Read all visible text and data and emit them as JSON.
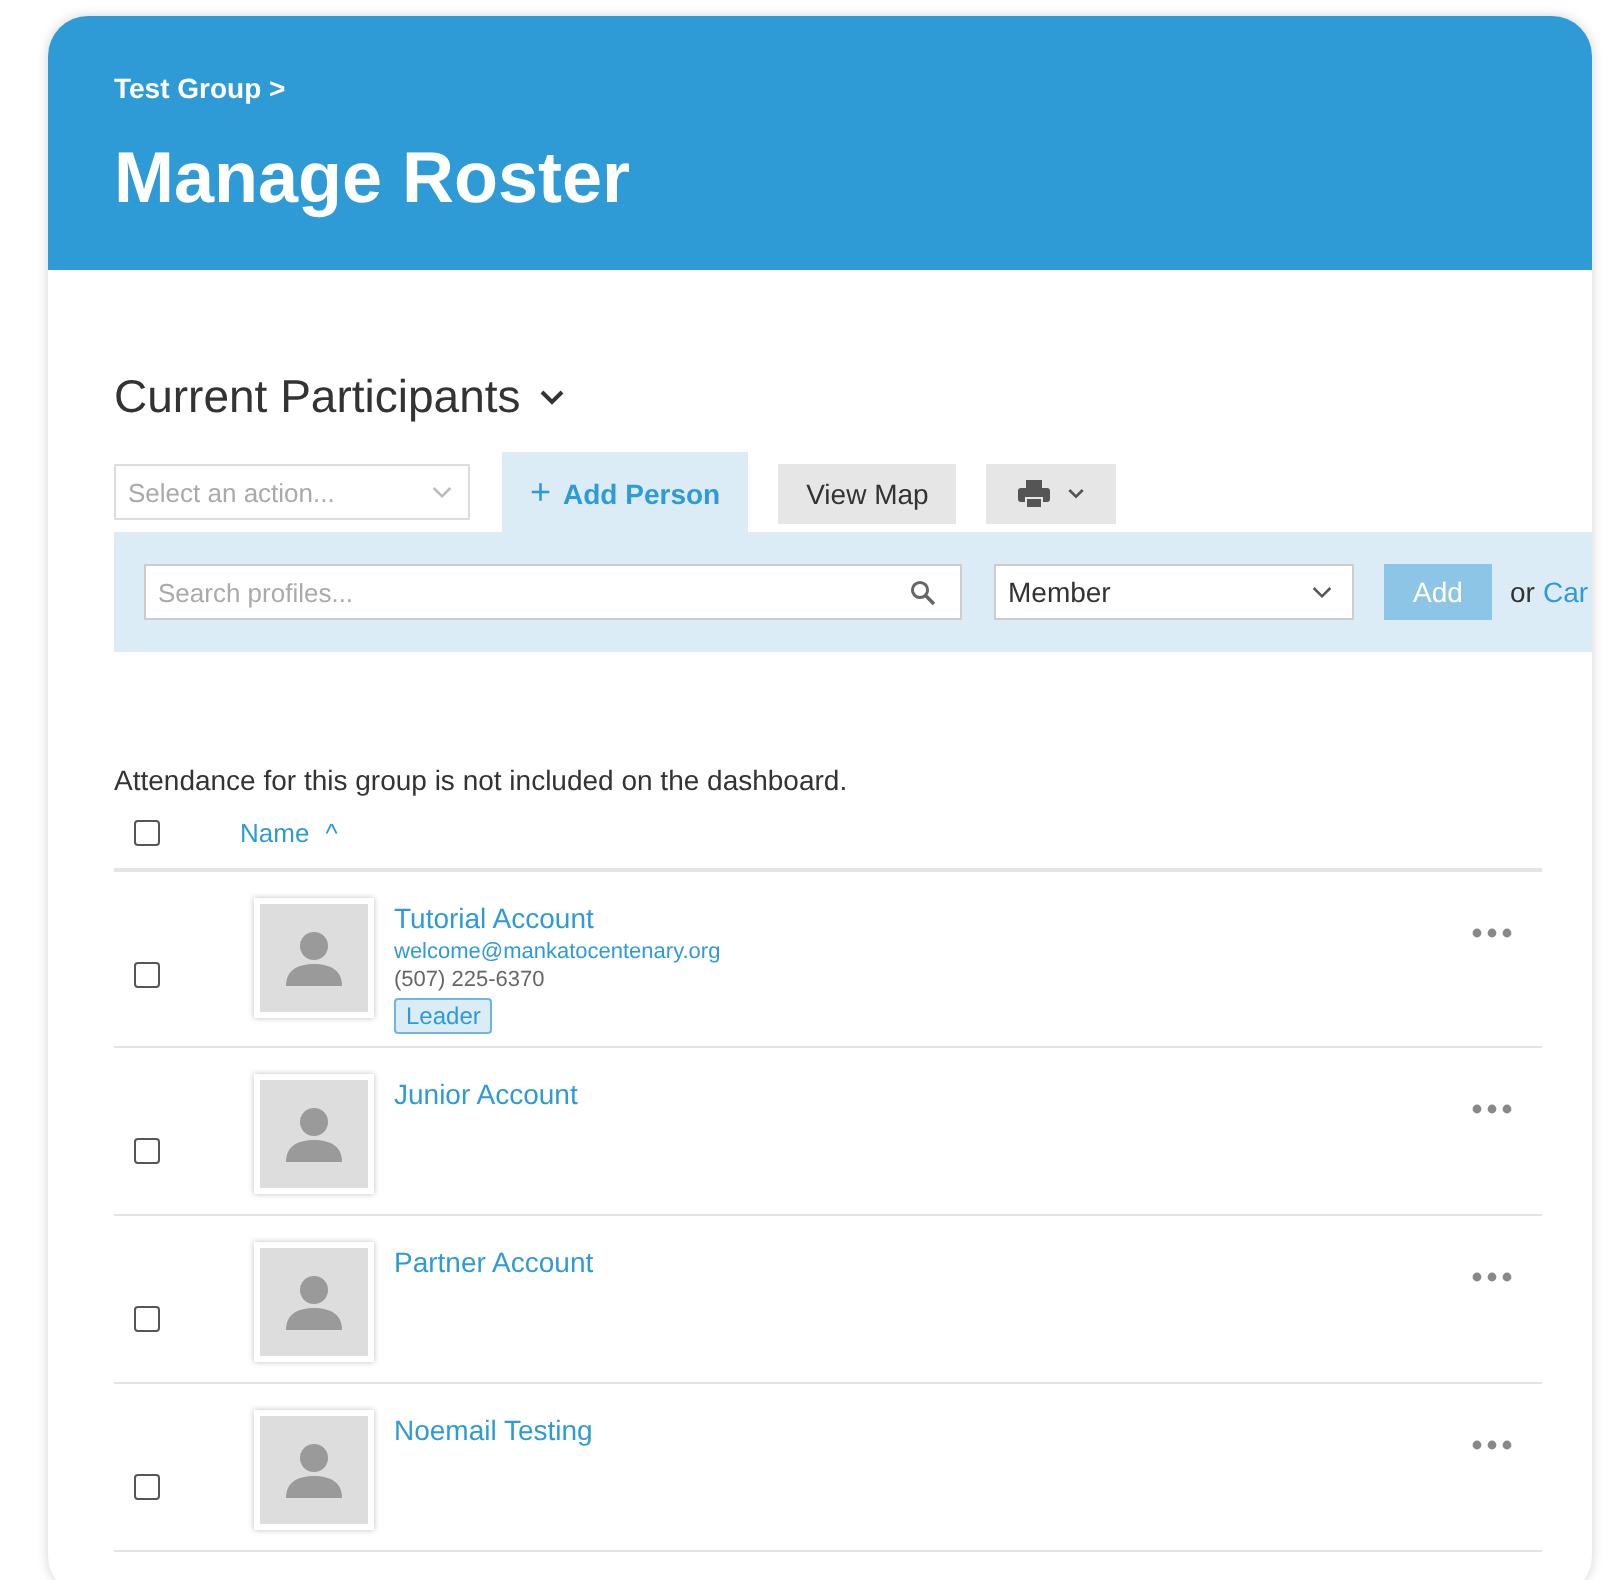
{
  "header": {
    "breadcrumb": "Test Group >",
    "title": "Manage Roster"
  },
  "section": {
    "title": "Current Participants"
  },
  "toolbar": {
    "action_select": {
      "placeholder": "Select an action..."
    },
    "tabs": [
      {
        "label": "Add Person",
        "icon": "+",
        "selected": true
      },
      {
        "label": "View Map",
        "selected": false
      }
    ]
  },
  "add_panel": {
    "search": {
      "placeholder": "Search profiles..."
    },
    "role_select": {
      "value": "Member"
    },
    "add_button": "Add",
    "or_text": "or",
    "cancel_link": "Car"
  },
  "notice": "Attendance for this group is not included on the dashboard.",
  "table": {
    "select_all": {
      "checked": false
    },
    "columns": [
      {
        "label": "Name",
        "sort": "^"
      }
    ],
    "rows": [
      {
        "checked": false,
        "name": "Tutorial Account",
        "email": "welcome@mankatocentenary.org",
        "phone": "(507) 225-6370",
        "badge": "Leader"
      },
      {
        "checked": false,
        "name": "Junior Account"
      },
      {
        "checked": false,
        "name": "Partner Account"
      },
      {
        "checked": false,
        "name": "Noemail Testing"
      }
    ]
  }
}
